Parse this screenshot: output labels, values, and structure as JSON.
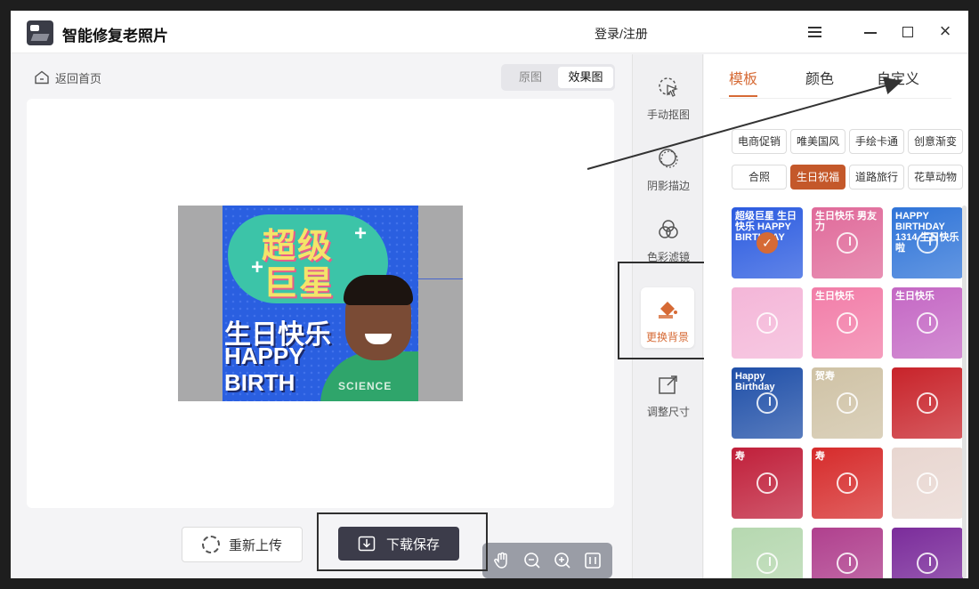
{
  "app": {
    "title": "智能修复老照片"
  },
  "header": {
    "login_label": "登录/注册"
  },
  "workspace": {
    "back_label": "返回首页",
    "view_toggle": {
      "original": "原图",
      "effect": "效果图"
    },
    "poster": {
      "line1": "超级",
      "line2": "巨星",
      "line3": "生日快乐",
      "line4": "HAPPY",
      "line5": "BIRTH",
      "shirt": "SCIENCE"
    },
    "zoom_tools": [
      "hand-icon",
      "zoom-out-icon",
      "zoom-in-icon",
      "fit-icon"
    ],
    "reupload_label": "重新上传",
    "download_label": "下载保存"
  },
  "tools": [
    {
      "label": "手动抠图",
      "icon": "cutout-cursor-icon"
    },
    {
      "label": "阴影描边",
      "icon": "shadow-outline-icon"
    },
    {
      "label": "色彩滤镜",
      "icon": "color-filter-icon"
    },
    {
      "label": "更换背景",
      "icon": "paint-bucket-icon",
      "active": true
    },
    {
      "label": "调整尺寸",
      "icon": "resize-icon"
    }
  ],
  "panel": {
    "tabs": [
      "模板",
      "颜色",
      "自定义"
    ],
    "active_tab": 0,
    "categories": [
      "电商促销",
      "唯美国风",
      "手绘卡通",
      "创意渐变",
      "合照",
      "生日祝福",
      "道路旅行",
      "花草动物"
    ],
    "active_category": 5,
    "templates": [
      {
        "caption": "超级巨星 生日快乐 HAPPY BIRTHDAY",
        "color": "#2b5be0",
        "selected": true
      },
      {
        "caption": "生日快乐 男友力",
        "color": "#e06a9a"
      },
      {
        "caption": "HAPPY BIRTHDAY 1314 生日快乐啦",
        "color": "#2f74d8"
      },
      {
        "caption": "",
        "color": "#f4b6d8"
      },
      {
        "caption": "生日快乐",
        "color": "#f27da8"
      },
      {
        "caption": "生日快乐",
        "color": "#c467c4"
      },
      {
        "caption": "Happy Birthday",
        "color": "#1f4fa8"
      },
      {
        "caption": "贺寿",
        "color": "#cfc2a5"
      },
      {
        "caption": "",
        "color": "#c8232a"
      },
      {
        "caption": "寿",
        "color": "#c01f3a"
      },
      {
        "caption": "寿",
        "color": "#d62b2b"
      },
      {
        "caption": "",
        "color": "#e8d6d0"
      },
      {
        "caption": "",
        "color": "#b6d8b0"
      },
      {
        "caption": "",
        "color": "#b0408e"
      },
      {
        "caption": "",
        "color": "#7b2c9b"
      }
    ]
  },
  "colors": {
    "accent": "#d66a35",
    "dark_button": "#3c3c4a"
  }
}
